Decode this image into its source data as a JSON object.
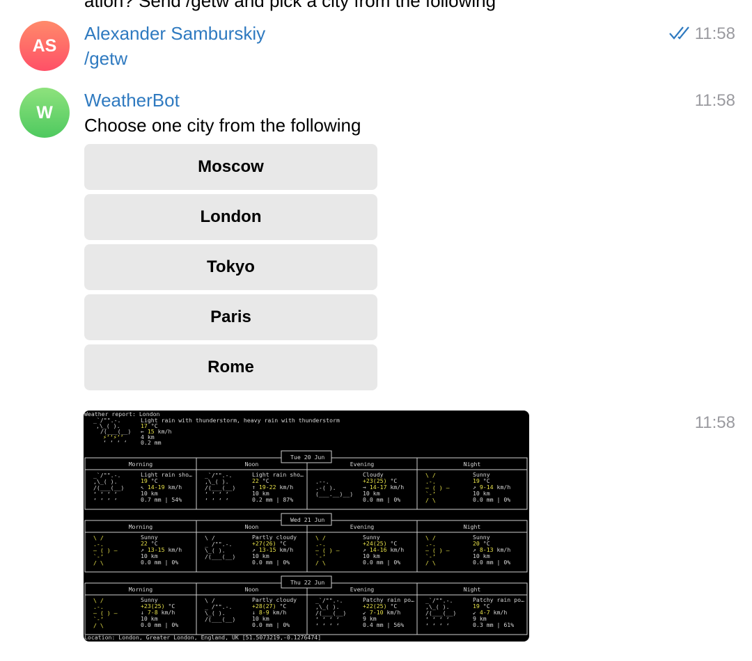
{
  "partial_top_text": "ation? Send /getw and pick a city from the following",
  "messages": [
    {
      "initials": "AS",
      "sender": "Alexander Samburskiy",
      "text": "/getw",
      "time": "11:58",
      "read": true
    },
    {
      "initials": "W",
      "sender": "WeatherBot",
      "text": "Choose one city from the following",
      "time": "11:58"
    }
  ],
  "keyboard": [
    "Moscow",
    "London",
    "Tokyo",
    "Paris",
    "Rome"
  ],
  "image_time": "11:58",
  "colors": {
    "link": "#2f7ac0",
    "time": "#9a9a9f",
    "button_bg": "#e8e8e8",
    "terminal_bg": "#000000"
  },
  "weather": {
    "report_title": "Weather report: London",
    "current": {
      "condition": "Light rain with thunderstorm, heavy rain with thunderstorm",
      "temp": "17",
      "temp_unit": "°C",
      "wind_arrow": "←",
      "wind": "15",
      "wind_unit": "km/h",
      "visibility": "4 km",
      "precip": "0.2 mm"
    },
    "period_headers": [
      "Morning",
      "Noon",
      "Evening",
      "Night"
    ],
    "days": [
      {
        "label": "Tue 20 Jun",
        "periods": [
          {
            "icon": "rain-shower-icon",
            "condition": "Light rain sho…",
            "temp": "19",
            "temp_unit": "°C",
            "wind_arrow": "↖",
            "wind": "14-19",
            "wind_unit": "km/h",
            "visibility": "10 km",
            "precip": "0.7 mm | 54%"
          },
          {
            "icon": "rain-shower-icon",
            "condition": "Light rain sho…",
            "temp": "22",
            "temp_unit": "°C",
            "wind_arrow": "↑",
            "wind": "19-22",
            "wind_unit": "km/h",
            "visibility": "10 km",
            "precip": "0.2 mm | 87%"
          },
          {
            "icon": "cloud-icon",
            "condition": "Cloudy",
            "temp": "+23(25)",
            "temp_unit": "°C",
            "wind_arrow": "→",
            "wind": "14-17",
            "wind_unit": "km/h",
            "visibility": "10 km",
            "precip": "0.0 mm | 0%"
          },
          {
            "icon": "sun-icon",
            "condition": "Sunny",
            "temp": "19",
            "temp_unit": "°C",
            "wind_arrow": "↗",
            "wind": "9-14",
            "wind_unit": "km/h",
            "visibility": "10 km",
            "precip": "0.0 mm | 0%"
          }
        ]
      },
      {
        "label": "Wed 21 Jun",
        "periods": [
          {
            "icon": "sun-icon",
            "condition": "Sunny",
            "temp": "22",
            "temp_unit": "°C",
            "wind_arrow": "↗",
            "wind": "13-15",
            "wind_unit": "km/h",
            "visibility": "10 km",
            "precip": "0.0 mm | 0%"
          },
          {
            "icon": "partly-cloudy-icon",
            "condition": "Partly cloudy",
            "temp": "+27(26)",
            "temp_unit": "°C",
            "wind_arrow": "↗",
            "wind": "13-15",
            "wind_unit": "km/h",
            "visibility": "10 km",
            "precip": "0.0 mm | 0%"
          },
          {
            "icon": "sun-icon",
            "condition": "Sunny",
            "temp": "+24(25)",
            "temp_unit": "°C",
            "wind_arrow": "↗",
            "wind": "14-16",
            "wind_unit": "km/h",
            "visibility": "10 km",
            "precip": "0.0 mm | 0%"
          },
          {
            "icon": "sun-icon",
            "condition": "Sunny",
            "temp": "20",
            "temp_unit": "°C",
            "wind_arrow": "↗",
            "wind": "8-13",
            "wind_unit": "km/h",
            "visibility": "10 km",
            "precip": "0.0 mm | 0%"
          }
        ]
      },
      {
        "label": "Thu 22 Jun",
        "periods": [
          {
            "icon": "sun-icon",
            "condition": "Sunny",
            "temp": "+23(25)",
            "temp_unit": "°C",
            "wind_arrow": "↓",
            "wind": "7-8",
            "wind_unit": "km/h",
            "visibility": "10 km",
            "precip": "0.0 mm | 0%"
          },
          {
            "icon": "partly-cloudy-icon",
            "condition": "Partly cloudy",
            "temp": "+28(27)",
            "temp_unit": "°C",
            "wind_arrow": "↓",
            "wind": "8-9",
            "wind_unit": "km/h",
            "visibility": "10 km",
            "precip": "0.0 mm | 0%"
          },
          {
            "icon": "rain-shower-icon",
            "condition": "Patchy rain po…",
            "temp": "+22(25)",
            "temp_unit": "°C",
            "wind_arrow": "↙",
            "wind": "7-10",
            "wind_unit": "km/h",
            "visibility": "9 km",
            "precip": "0.4 mm | 56%"
          },
          {
            "icon": "rain-shower-icon",
            "condition": "Patchy rain po…",
            "temp": "19",
            "temp_unit": "°C",
            "wind_arrow": "↙",
            "wind": "4-7",
            "wind_unit": "km/h",
            "visibility": "9 km",
            "precip": "0.3 mm | 61%"
          }
        ]
      }
    ],
    "location": "Location: London, Greater London, England, UK [51.5073219,-0.1276474]"
  }
}
